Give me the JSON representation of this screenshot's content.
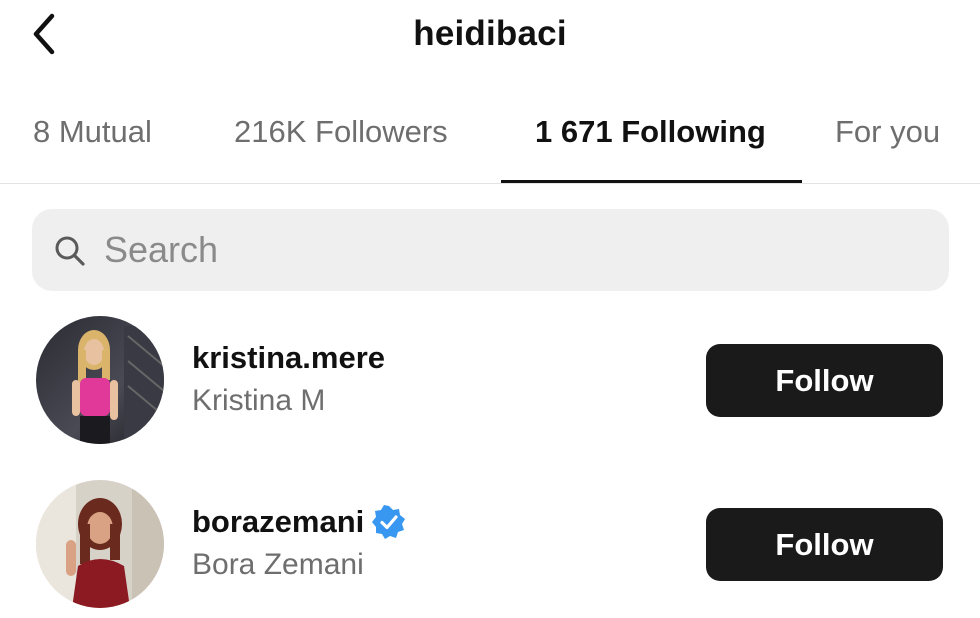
{
  "header": {
    "title": "heidibaci",
    "back_icon": "chevron-left-icon"
  },
  "tabs": [
    {
      "label": "8 Mutual",
      "active": false
    },
    {
      "label": "216K Followers",
      "active": false
    },
    {
      "label": "1 671 Following",
      "active": true
    },
    {
      "label": "For you",
      "active": false
    }
  ],
  "search": {
    "placeholder": "Search",
    "value": "",
    "icon": "search-icon"
  },
  "accounts": [
    {
      "username": "kristina.mere",
      "full_name": "Kristina M",
      "verified": false,
      "button_label": "Follow"
    },
    {
      "username": "borazemani",
      "full_name": "Bora Zemani",
      "verified": true,
      "button_label": "Follow"
    }
  ],
  "colors": {
    "button_bg": "#1a1a1a",
    "verified_blue": "#3897f0",
    "search_bg": "#efefef",
    "muted_text": "#6e6e6e"
  }
}
